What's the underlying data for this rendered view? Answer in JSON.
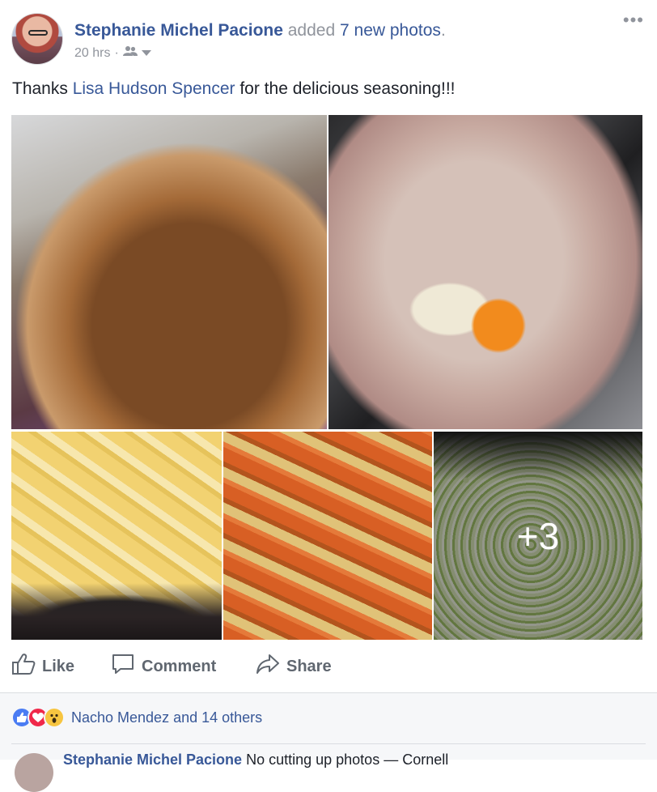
{
  "post": {
    "author": "Stephanie Michel Pacione",
    "action_prefix": "added",
    "action_link": "7 new photos",
    "action_suffix": ".",
    "time": "20 hrs",
    "separator": "·",
    "more_icon": "ellipsis-icon",
    "text_before": "Thanks ",
    "tagged": "Lisa Hudson Spencer",
    "text_after": " for the delicious seasoning!!!"
  },
  "photos": {
    "hidden_count": "+3",
    "items": [
      "Roasted turkey",
      "Seasoned raw turkey",
      "Cubed potatoes",
      "Roasted sweet potatoes",
      "Diced celery"
    ]
  },
  "actions": {
    "like": "Like",
    "comment": "Comment",
    "share": "Share"
  },
  "reactions": {
    "summary": "Nacho Mendez and 14 others",
    "types": [
      "like",
      "love",
      "wow"
    ]
  },
  "next_comment": {
    "author": "Stephanie Michel Pacione",
    "text": "No cutting up photos —  Cornell"
  },
  "colors": {
    "link": "#385898",
    "muted": "#90949c",
    "like": "#4a7cf3",
    "love": "#f0284a",
    "wow": "#f7c540"
  }
}
